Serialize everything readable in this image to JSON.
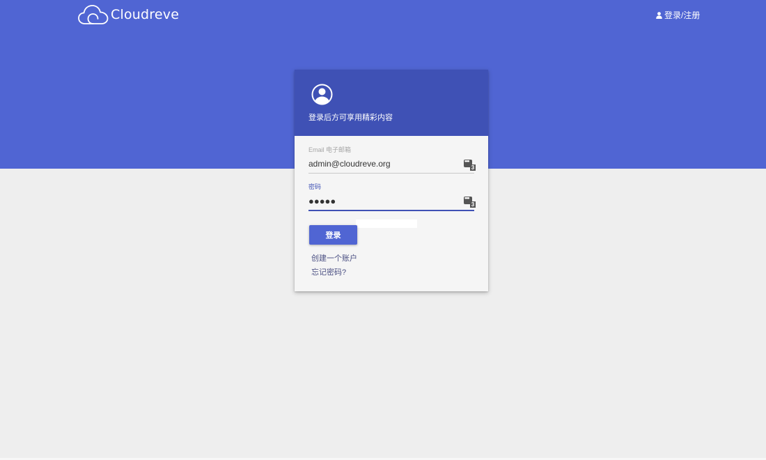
{
  "brand": {
    "name": "Cloudreve"
  },
  "nav": {
    "login_register": "登录/注册"
  },
  "login_card": {
    "title": "登录后方可享用精彩内容",
    "email": {
      "label": "Email 电子邮箱",
      "value": "admin@cloudreve.org"
    },
    "password": {
      "label": "密码",
      "value": "●●●●●"
    },
    "password_manager_count": "3",
    "submit_label": "登录",
    "create_account_link": "创建一个账户",
    "forgot_password_link": "忘记密码?"
  },
  "colors": {
    "hero_background": "#5065d3",
    "card_header": "#3f51b5",
    "page_background": "#eeeeee",
    "card_body": "#f5f5f5",
    "link_text": "#4a4f82"
  },
  "icons": {
    "logo": "cloud-icon",
    "nav_user": "user-icon",
    "avatar": "account-circle-icon",
    "password_manager": "password-manager-icon"
  }
}
